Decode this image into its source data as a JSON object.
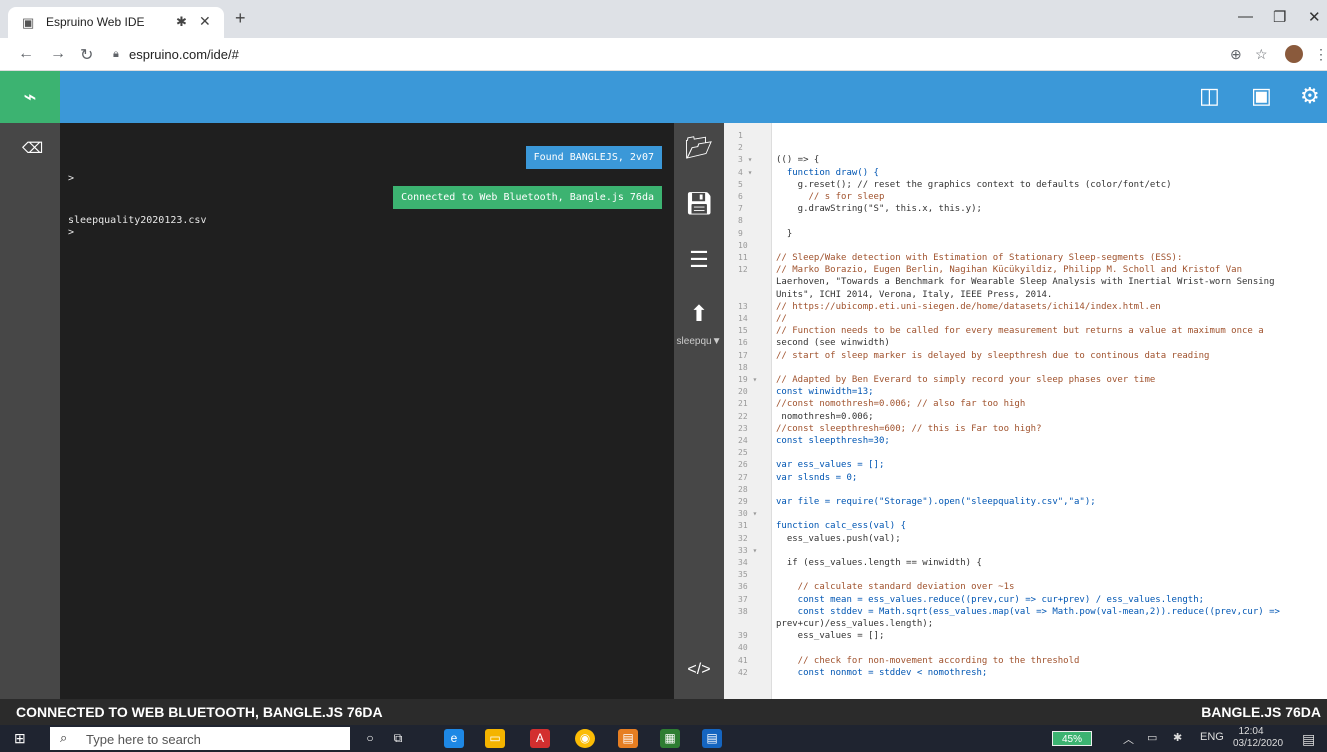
{
  "browser": {
    "tab_title": "Espruino Web IDE",
    "url": "espruino.com/ide/#",
    "window_controls": [
      "minimize-icon",
      "restore-icon",
      "close-icon"
    ]
  },
  "terminal": {
    "prompt_1": ">",
    "filename": "sleepquality2020123.csv",
    "prompt_2": ">",
    "toast_found": "Found BANGLEJS, 2v07",
    "toast_connected": "Connected to Web Bluetooth, Bangle.js 76da"
  },
  "toolbar": {
    "file_label": "sleepqu"
  },
  "editor": {
    "line_numbers": [
      "1",
      "2",
      "3 ▾",
      "4 ▾",
      "5",
      "6",
      "7",
      "8",
      "9",
      "10",
      "11",
      "12",
      "13",
      "14",
      "15",
      "16",
      "17",
      "18",
      "19 ▾",
      "20",
      "21",
      "22",
      "23",
      "24",
      "25",
      "26",
      "27",
      "28",
      "29",
      "30 ▾",
      "31",
      "32",
      "33 ▾",
      "34",
      "35",
      "36",
      "37",
      "38",
      "39",
      "40",
      "41",
      "42"
    ],
    "lines": [
      "",
      "",
      "(() => {",
      "  function draw() {",
      "    g.reset(); // reset the graphics context to defaults (color/font/etc)",
      "      // s for sleep",
      "    g.drawString(\"S\", this.x, this.y);",
      "",
      "  }",
      "",
      "// Sleep/Wake detection with Estimation of Stationary Sleep-segments (ESS):",
      "// Marko Borazio, Eugen Berlin, Nagihan Kücükyildiz, Philipp M. Scholl and Kristof Van",
      "Laerhoven, \"Towards a Benchmark for Wearable Sleep Analysis with Inertial Wrist-worn Sensing",
      "Units\", ICHI 2014, Verona, Italy, IEEE Press, 2014.",
      "// https://ubicomp.eti.uni-siegen.de/home/datasets/ichi14/index.html.en",
      "//",
      "// Function needs to be called for every measurement but returns a value at maximum once a",
      "second (see winwidth)",
      "// start of sleep marker is delayed by sleepthresh due to continous data reading",
      "",
      "// Adapted by Ben Everard to simply record your sleep phases over time",
      "const winwidth=13;",
      "//const nomothresh=0.006; // also far too high",
      " nomothresh=0.006;",
      "//const sleepthresh=600; // this is Far too high?",
      "const sleepthresh=30;",
      "",
      "var ess_values = [];",
      "var slsnds = 0;",
      "",
      "var file = require(\"Storage\").open(\"sleepquality.csv\",\"a\");",
      "",
      "function calc_ess(val) {",
      "  ess_values.push(val);",
      "",
      "  if (ess_values.length == winwidth) {",
      "",
      "    // calculate standard deviation over ~1s",
      "    const mean = ess_values.reduce((prev,cur) => cur+prev) / ess_values.length;",
      "    const stddev = Math.sqrt(ess_values.map(val => Math.pow(val-mean,2)).reduce((prev,cur) =>",
      "prev+cur)/ess_values.length);",
      "    ess_values = [];",
      "",
      "    // check for non-movement according to the threshold",
      "    const nonmot = stddev < nomothresh;"
    ]
  },
  "status": {
    "left": "CONNECTED TO WEB BLUETOOTH, BANGLE.JS 76DA",
    "right": "BANGLE.JS 76DA"
  },
  "taskbar": {
    "search_placeholder": "Type here to search",
    "battery": "45%",
    "lang": "ENG",
    "time": "12:04",
    "date": "03/12/2020"
  }
}
